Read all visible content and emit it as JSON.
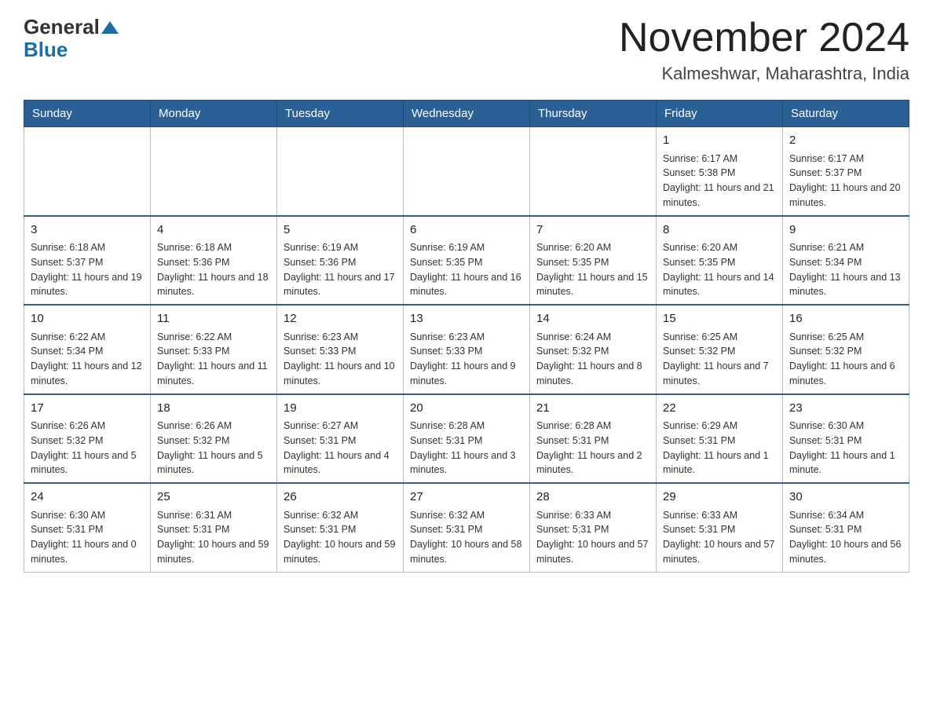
{
  "logo": {
    "general": "General",
    "blue": "Blue"
  },
  "title": "November 2024",
  "location": "Kalmeshwar, Maharashtra, India",
  "days_of_week": [
    "Sunday",
    "Monday",
    "Tuesday",
    "Wednesday",
    "Thursday",
    "Friday",
    "Saturday"
  ],
  "weeks": [
    [
      {
        "day": "",
        "sunrise": "",
        "sunset": "",
        "daylight": ""
      },
      {
        "day": "",
        "sunrise": "",
        "sunset": "",
        "daylight": ""
      },
      {
        "day": "",
        "sunrise": "",
        "sunset": "",
        "daylight": ""
      },
      {
        "day": "",
        "sunrise": "",
        "sunset": "",
        "daylight": ""
      },
      {
        "day": "",
        "sunrise": "",
        "sunset": "",
        "daylight": ""
      },
      {
        "day": "1",
        "sunrise": "Sunrise: 6:17 AM",
        "sunset": "Sunset: 5:38 PM",
        "daylight": "Daylight: 11 hours and 21 minutes."
      },
      {
        "day": "2",
        "sunrise": "Sunrise: 6:17 AM",
        "sunset": "Sunset: 5:37 PM",
        "daylight": "Daylight: 11 hours and 20 minutes."
      }
    ],
    [
      {
        "day": "3",
        "sunrise": "Sunrise: 6:18 AM",
        "sunset": "Sunset: 5:37 PM",
        "daylight": "Daylight: 11 hours and 19 minutes."
      },
      {
        "day": "4",
        "sunrise": "Sunrise: 6:18 AM",
        "sunset": "Sunset: 5:36 PM",
        "daylight": "Daylight: 11 hours and 18 minutes."
      },
      {
        "day": "5",
        "sunrise": "Sunrise: 6:19 AM",
        "sunset": "Sunset: 5:36 PM",
        "daylight": "Daylight: 11 hours and 17 minutes."
      },
      {
        "day": "6",
        "sunrise": "Sunrise: 6:19 AM",
        "sunset": "Sunset: 5:35 PM",
        "daylight": "Daylight: 11 hours and 16 minutes."
      },
      {
        "day": "7",
        "sunrise": "Sunrise: 6:20 AM",
        "sunset": "Sunset: 5:35 PM",
        "daylight": "Daylight: 11 hours and 15 minutes."
      },
      {
        "day": "8",
        "sunrise": "Sunrise: 6:20 AM",
        "sunset": "Sunset: 5:35 PM",
        "daylight": "Daylight: 11 hours and 14 minutes."
      },
      {
        "day": "9",
        "sunrise": "Sunrise: 6:21 AM",
        "sunset": "Sunset: 5:34 PM",
        "daylight": "Daylight: 11 hours and 13 minutes."
      }
    ],
    [
      {
        "day": "10",
        "sunrise": "Sunrise: 6:22 AM",
        "sunset": "Sunset: 5:34 PM",
        "daylight": "Daylight: 11 hours and 12 minutes."
      },
      {
        "day": "11",
        "sunrise": "Sunrise: 6:22 AM",
        "sunset": "Sunset: 5:33 PM",
        "daylight": "Daylight: 11 hours and 11 minutes."
      },
      {
        "day": "12",
        "sunrise": "Sunrise: 6:23 AM",
        "sunset": "Sunset: 5:33 PM",
        "daylight": "Daylight: 11 hours and 10 minutes."
      },
      {
        "day": "13",
        "sunrise": "Sunrise: 6:23 AM",
        "sunset": "Sunset: 5:33 PM",
        "daylight": "Daylight: 11 hours and 9 minutes."
      },
      {
        "day": "14",
        "sunrise": "Sunrise: 6:24 AM",
        "sunset": "Sunset: 5:32 PM",
        "daylight": "Daylight: 11 hours and 8 minutes."
      },
      {
        "day": "15",
        "sunrise": "Sunrise: 6:25 AM",
        "sunset": "Sunset: 5:32 PM",
        "daylight": "Daylight: 11 hours and 7 minutes."
      },
      {
        "day": "16",
        "sunrise": "Sunrise: 6:25 AM",
        "sunset": "Sunset: 5:32 PM",
        "daylight": "Daylight: 11 hours and 6 minutes."
      }
    ],
    [
      {
        "day": "17",
        "sunrise": "Sunrise: 6:26 AM",
        "sunset": "Sunset: 5:32 PM",
        "daylight": "Daylight: 11 hours and 5 minutes."
      },
      {
        "day": "18",
        "sunrise": "Sunrise: 6:26 AM",
        "sunset": "Sunset: 5:32 PM",
        "daylight": "Daylight: 11 hours and 5 minutes."
      },
      {
        "day": "19",
        "sunrise": "Sunrise: 6:27 AM",
        "sunset": "Sunset: 5:31 PM",
        "daylight": "Daylight: 11 hours and 4 minutes."
      },
      {
        "day": "20",
        "sunrise": "Sunrise: 6:28 AM",
        "sunset": "Sunset: 5:31 PM",
        "daylight": "Daylight: 11 hours and 3 minutes."
      },
      {
        "day": "21",
        "sunrise": "Sunrise: 6:28 AM",
        "sunset": "Sunset: 5:31 PM",
        "daylight": "Daylight: 11 hours and 2 minutes."
      },
      {
        "day": "22",
        "sunrise": "Sunrise: 6:29 AM",
        "sunset": "Sunset: 5:31 PM",
        "daylight": "Daylight: 11 hours and 1 minute."
      },
      {
        "day": "23",
        "sunrise": "Sunrise: 6:30 AM",
        "sunset": "Sunset: 5:31 PM",
        "daylight": "Daylight: 11 hours and 1 minute."
      }
    ],
    [
      {
        "day": "24",
        "sunrise": "Sunrise: 6:30 AM",
        "sunset": "Sunset: 5:31 PM",
        "daylight": "Daylight: 11 hours and 0 minutes."
      },
      {
        "day": "25",
        "sunrise": "Sunrise: 6:31 AM",
        "sunset": "Sunset: 5:31 PM",
        "daylight": "Daylight: 10 hours and 59 minutes."
      },
      {
        "day": "26",
        "sunrise": "Sunrise: 6:32 AM",
        "sunset": "Sunset: 5:31 PM",
        "daylight": "Daylight: 10 hours and 59 minutes."
      },
      {
        "day": "27",
        "sunrise": "Sunrise: 6:32 AM",
        "sunset": "Sunset: 5:31 PM",
        "daylight": "Daylight: 10 hours and 58 minutes."
      },
      {
        "day": "28",
        "sunrise": "Sunrise: 6:33 AM",
        "sunset": "Sunset: 5:31 PM",
        "daylight": "Daylight: 10 hours and 57 minutes."
      },
      {
        "day": "29",
        "sunrise": "Sunrise: 6:33 AM",
        "sunset": "Sunset: 5:31 PM",
        "daylight": "Daylight: 10 hours and 57 minutes."
      },
      {
        "day": "30",
        "sunrise": "Sunrise: 6:34 AM",
        "sunset": "Sunset: 5:31 PM",
        "daylight": "Daylight: 10 hours and 56 minutes."
      }
    ]
  ]
}
